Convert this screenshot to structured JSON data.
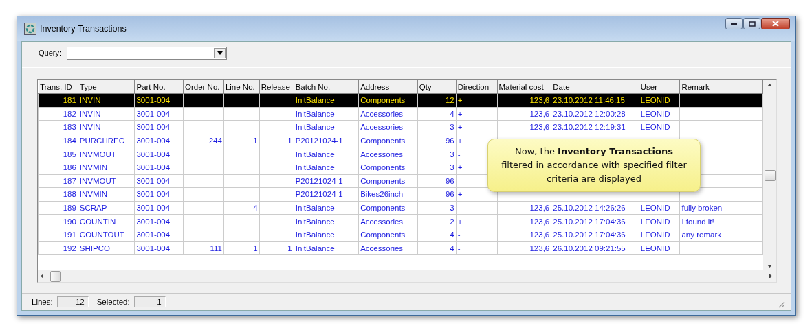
{
  "window": {
    "title": "Inventory Transactions"
  },
  "query": {
    "label": "Query:"
  },
  "table": {
    "columns": [
      "Trans. ID",
      "Type",
      "Part No.",
      "Order No.",
      "Line No.",
      "Release",
      "Batch No.",
      "Address",
      "Qty",
      "Direction",
      "Material cost",
      "Date",
      "User",
      "Remark"
    ],
    "rows": [
      {
        "selected": true,
        "cells": [
          "181",
          "INVIN",
          "3001-004",
          null,
          null,
          null,
          "InitBalance",
          "Components",
          "12",
          "+",
          "123,6",
          "23.10.2012 11:46:15",
          "LEONID",
          null
        ]
      },
      {
        "selected": false,
        "cells": [
          "182",
          "INVIN",
          "3001-004",
          null,
          null,
          null,
          "InitBalance",
          "Accessories",
          "4",
          "+",
          "123,6",
          "23.10.2012 12:00:28",
          "LEONID",
          null
        ]
      },
      {
        "selected": false,
        "cells": [
          "183",
          "INVIN",
          "3001-004",
          null,
          null,
          null,
          "InitBalance",
          "Accessories",
          "3",
          "+",
          "123,6",
          "23.10.2012 12:19:31",
          "LEONID",
          null
        ]
      },
      {
        "selected": false,
        "cells": [
          "184",
          "PURCHREC",
          "3001-004",
          "244",
          "1",
          "1",
          "P20121024-1",
          "Components",
          "96",
          "+",
          null,
          null,
          null,
          null
        ]
      },
      {
        "selected": false,
        "cells": [
          "185",
          "INVMOUT",
          "3001-004",
          null,
          null,
          null,
          "InitBalance",
          "Accessories",
          "3",
          "-",
          null,
          null,
          null,
          null
        ]
      },
      {
        "selected": false,
        "cells": [
          "186",
          "INVMIN",
          "3001-004",
          null,
          null,
          null,
          "InitBalance",
          "Components",
          "3",
          "+",
          null,
          null,
          null,
          null
        ]
      },
      {
        "selected": false,
        "cells": [
          "187",
          "INVMOUT",
          "3001-004",
          null,
          null,
          null,
          "P20121024-1",
          "Components",
          "96",
          "-",
          null,
          null,
          null,
          null
        ]
      },
      {
        "selected": false,
        "cells": [
          "188",
          "INVMIN",
          "3001-004",
          null,
          null,
          null,
          "P20121024-1",
          "Bikes26inch",
          "96",
          "+",
          null,
          null,
          null,
          null
        ]
      },
      {
        "selected": false,
        "cells": [
          "189",
          "SCRAP",
          "3001-004",
          null,
          "4",
          null,
          "InitBalance",
          "Components",
          "3",
          "-",
          "123,6",
          "25.10.2012 14:26:26",
          "LEONID",
          "fully broken"
        ]
      },
      {
        "selected": false,
        "cells": [
          "190",
          "COUNTIN",
          "3001-004",
          null,
          null,
          null,
          "InitBalance",
          "Accessories",
          "2",
          "+",
          "123,6",
          "25.10.2012 17:04:36",
          "LEONID",
          "I found it!"
        ]
      },
      {
        "selected": false,
        "cells": [
          "191",
          "COUNTOUT",
          "3001-004",
          null,
          null,
          null,
          "InitBalance",
          "Components",
          "4",
          "-",
          "123,6",
          "25.10.2012 17:04:36",
          "LEONID",
          "any remark"
        ]
      },
      {
        "selected": false,
        "cells": [
          "192",
          "SHIPCO",
          "3001-004",
          "111",
          "1",
          "1",
          "InitBalance",
          "Accessories",
          "4",
          "-",
          "123,6",
          "26.10.2012 09:21:55",
          "LEONID",
          null
        ]
      }
    ]
  },
  "callout": {
    "text": "Now, the **Inventory Transactions** filtered in accordance with specified filter criteria are displayed"
  },
  "status_bar": {
    "lines_label": "Lines:",
    "lines_value": "12",
    "selected_label": "Selected:",
    "selected_value": "1"
  }
}
